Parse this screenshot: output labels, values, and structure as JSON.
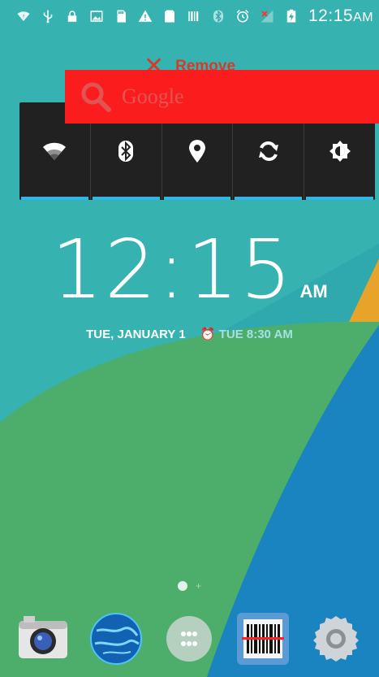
{
  "status_bar": {
    "icons": [
      "wifi-question-icon",
      "usb-icon",
      "lock-icon",
      "image-icon",
      "sd-card-icon",
      "warning-icon",
      "sim-icon",
      "barcode-icon",
      "bluetooth-icon",
      "alarm-icon",
      "no-signal-icon",
      "battery-charging-icon"
    ],
    "time": "12:15",
    "ampm": "AM"
  },
  "drop_target": {
    "label": "Remove"
  },
  "search_widget": {
    "label": "Google"
  },
  "power_widget": {
    "buttons": [
      "wifi-toggle",
      "bluetooth-toggle",
      "location-toggle",
      "sync-toggle",
      "brightness-toggle"
    ]
  },
  "clock": {
    "time": "12:15",
    "ampm": "AM",
    "date": "TUE, JANUARY 1",
    "alarm": "TUE 8:30 AM"
  },
  "dock": {
    "apps": [
      "Camera",
      "Browser",
      "All apps",
      "Barcode scanner",
      "Settings"
    ]
  },
  "colors": {
    "accent": "#33b5e5",
    "search_bar": "#fb1d1d",
    "remove": "#d83a2a"
  }
}
